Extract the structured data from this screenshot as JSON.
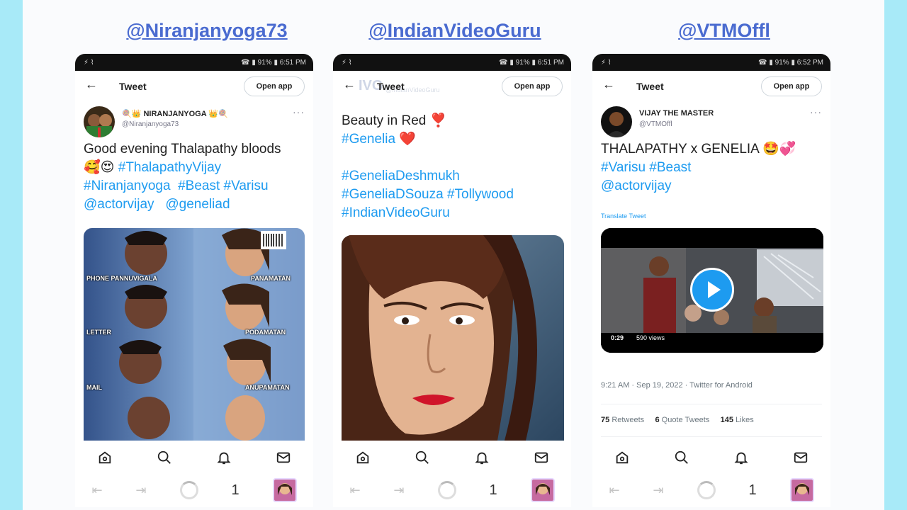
{
  "columns": [
    {
      "handle_label": "@Niranjanyoga73",
      "status": {
        "left": "⚡ ⌇",
        "right": "☎ ▮ 91% ▮ 6:51 PM"
      },
      "topbar": {
        "back": "←",
        "title": "Tweet",
        "open_app": "Open app"
      },
      "author": {
        "name": "🍭👑 NIRANJANYOGA 👑🍭",
        "handle": "@Niranjanyoga73",
        "more": "···"
      },
      "text": {
        "l1": "Good evening Thalapathy bloods",
        "l2_emoji": "🥰😍",
        "l2_tag": "#ThalapathyVijay",
        "l3a": "#Niranjanyoga",
        "l3b": "#Beast",
        "l3c": "#Varisu",
        "l4a": "@actorvijay",
        "l4b": "@geneliad"
      },
      "meme_captions": [
        "PHONE PANNUVIGALA",
        "PANAMATAN",
        "LETTER",
        "PODAMATAN",
        "MAIL",
        "ANUPAMATAN"
      ]
    },
    {
      "handle_label": "@IndianVideoGuru",
      "status": {
        "left": "⚡ ⌇",
        "right": "☎ ▮ 91% ▮ 6:51 PM"
      },
      "topbar": {
        "back": "←",
        "title": "Tweet",
        "open_app": "Open app"
      },
      "watermark": "IVG",
      "watermark_sub": "@IndianVideoGuru",
      "text": {
        "l1": "Beauty in Red",
        "l1_emoji": "❣️",
        "l2": "#Genelia",
        "l2_emoji": "❤️",
        "l3": "#GeneliaDeshmukh",
        "l4a": "#GeneliaDSouza",
        "l4b": "#Tollywood",
        "l5": "#IndianVideoGuru"
      }
    },
    {
      "handle_label": "@VTMOffl",
      "status": {
        "left": "⚡ ⌇",
        "right": "☎ ▮ 91% ▮ 6:52 PM"
      },
      "topbar": {
        "back": "←",
        "title": "Tweet",
        "open_app": "Open app"
      },
      "author": {
        "name": "VIJAY THE MASTER",
        "handle": "@VTMOffl",
        "more": "···"
      },
      "text": {
        "l1": "THALAPATHY x GENELIA",
        "l1_emoji": "🤩💞",
        "l2a": "#Varisu",
        "l2b": "#Beast",
        "l3": "@actorvijay"
      },
      "translate": "Translate Tweet",
      "video": {
        "time": "0:29",
        "views": "590 views"
      },
      "meta": "9:21 AM · Sep 19, 2022 · Twitter for Android",
      "stats": {
        "retweets_count": "75",
        "retweets_label": "Retweets",
        "quotes_count": "6",
        "quotes_label": "Quote Tweets",
        "likes_count": "145",
        "likes_label": "Likes"
      }
    }
  ],
  "browser": {
    "back": "⇤",
    "forward": "⇥",
    "tab_count": "1"
  },
  "colors": {
    "link": "#1d9bf0",
    "handle_label": "#4a6bd0",
    "background": "#a8eaf8"
  }
}
